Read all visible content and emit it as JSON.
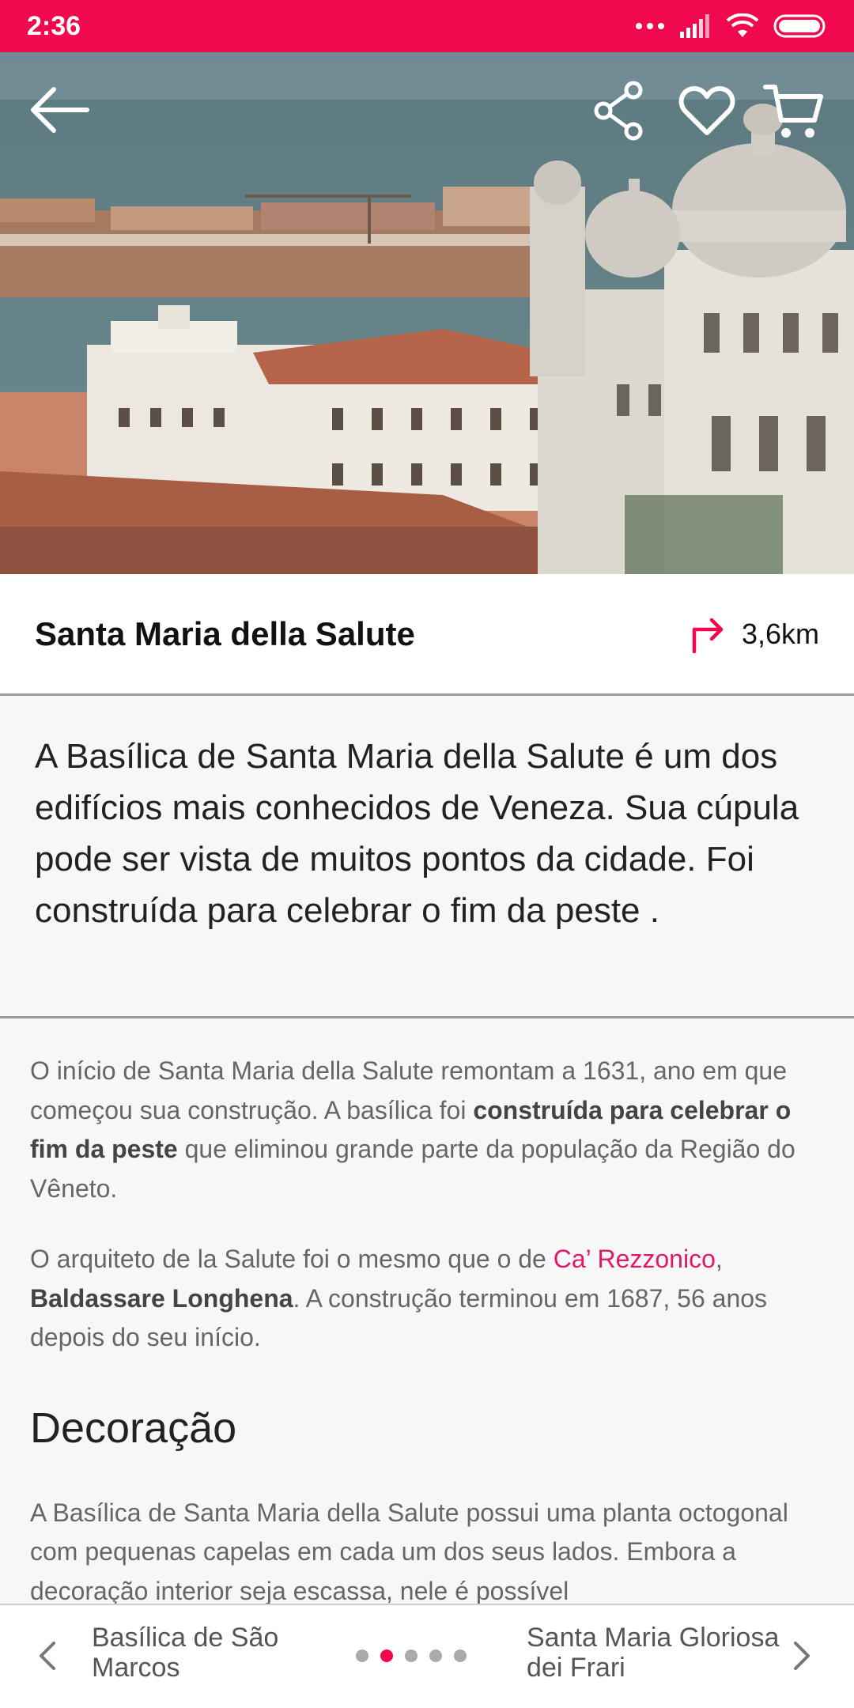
{
  "status": {
    "time": "2:36"
  },
  "header": {
    "back_icon": "arrow-left-icon",
    "share_icon": "share-icon",
    "favorite_icon": "heart-icon",
    "cart_icon": "cart-icon"
  },
  "place": {
    "title": "Santa Maria della Salute",
    "distance": "3,6km",
    "directions_icon": "turn-right-arrow-icon"
  },
  "lead": "A Basílica de Santa Maria della Salute é um dos edifícios mais conhecidos de Veneza. Sua cúpula pode ser vista de muitos pontos da cidade.  Foi construída para celebrar o fim da peste .",
  "body": {
    "p1_a": "O início de Santa Maria della Salute remontam a 1631, ano em que começou sua construção. A basílica foi ",
    "p1_bold": "construída para celebrar o fim da peste",
    "p1_b": " que eliminou grande parte da população da Região do Vêneto.",
    "p2_a": "O arquiteto de la Salute foi o mesmo que o de ",
    "p2_link": "Ca’ Rezzonico",
    "p2_b": ", ",
    "p2_bold": "Baldassare Longhena",
    "p2_c": ". A construção terminou em 1687, 56 anos depois do seu início.",
    "section_title": "Decoração",
    "p3": "A Basílica de Santa Maria della Salute possui uma planta octogonal com pequenas capelas em cada um dos seus lados. Embora a decoração interior seja escassa, nele é possível"
  },
  "nav": {
    "prev_label": "Basílica de São Marcos",
    "next_label": "Santa Maria Gloriosa dei Frari",
    "dots_total": 5,
    "dots_active_index": 1
  },
  "colors": {
    "accent": "#f0094d",
    "link": "#e01a6b"
  }
}
